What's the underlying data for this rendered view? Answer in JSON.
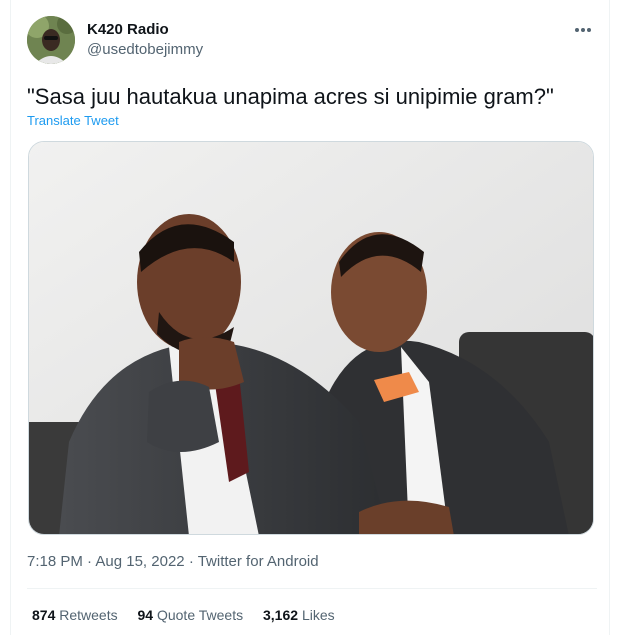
{
  "author": {
    "display_name": "K420 Radio",
    "handle": "@usedtobejimmy"
  },
  "more_icon": "more-horizontal-icon",
  "tweet": {
    "text": "\"Sasa juu hautakua unapima acres si unipimie gram?\"",
    "translate_label": "Translate Tweet"
  },
  "meta": {
    "time": "7:18 PM",
    "date": "Aug 15, 2022",
    "source": "Twitter for Android",
    "separator": "·"
  },
  "stats": {
    "retweets_count": "874",
    "retweets_label": "Retweets",
    "quotes_count": "94",
    "quotes_label": "Quote Tweets",
    "likes_count": "3,162",
    "likes_label": "Likes"
  },
  "colors": {
    "link": "#1d9bf0",
    "secondary_text": "#536471",
    "primary_text": "#0f1419"
  }
}
